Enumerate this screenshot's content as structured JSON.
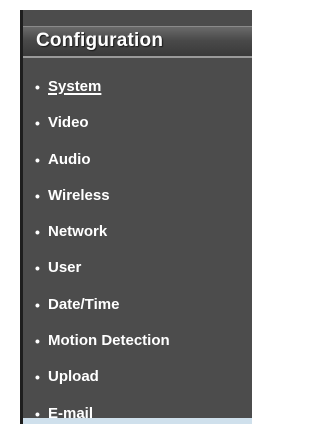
{
  "panel": {
    "title": "Configuration"
  },
  "menu": {
    "items": [
      {
        "label": "System",
        "active": true
      },
      {
        "label": "Video",
        "active": false
      },
      {
        "label": "Audio",
        "active": false
      },
      {
        "label": "Wireless",
        "active": false
      },
      {
        "label": "Network",
        "active": false
      },
      {
        "label": "User",
        "active": false
      },
      {
        "label": "Date/Time",
        "active": false
      },
      {
        "label": "Motion Detection",
        "active": false
      },
      {
        "label": "Upload",
        "active": false
      },
      {
        "label": "E-mail",
        "active": false
      }
    ],
    "bullet": "•"
  },
  "colors": {
    "panel_background": "#4c4c4c",
    "text": "#ffffff",
    "header_border": "#9a9a9a"
  }
}
